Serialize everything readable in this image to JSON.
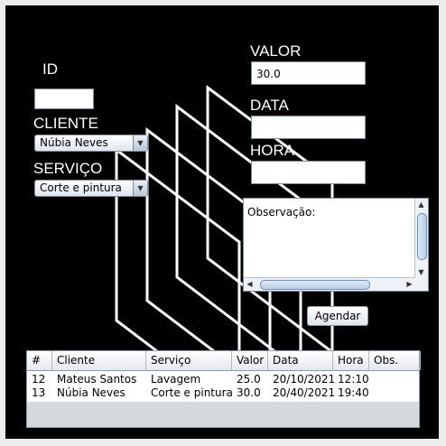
{
  "form": {
    "id_label": "ID",
    "id_value": "",
    "cliente_label": "CLIENTE",
    "cliente_selected": "Núbia Neves",
    "servico_label": "SERVIÇO",
    "servico_selected": "Corte e pintura",
    "valor_label": "VALOR",
    "valor_value": "30.0",
    "data_label": "DATA",
    "data_value": "",
    "hora_label": "HORA",
    "hora_value": "",
    "observacao_text": "Observação:",
    "agendar_label": "Agendar"
  },
  "table": {
    "headers": [
      "#",
      "Cliente",
      "Serviço",
      "Valor",
      "Data",
      "Hora",
      "Obs."
    ],
    "rows": [
      [
        "12",
        "Mateus Santos",
        "Lavagem",
        "25.0",
        "20/10/2021",
        "12:10",
        ""
      ],
      [
        "13",
        "Núbia Neves",
        "Corte e pintura",
        "30.0",
        "20/40/2021",
        "19:40",
        ""
      ]
    ]
  },
  "icons": {
    "combo_arrow": "chevron-down-icon",
    "scroll_up": "arrow-up-icon",
    "scroll_down": "arrow-down-icon",
    "scroll_left": "arrow-left-icon",
    "scroll_right": "arrow-right-icon"
  },
  "colors": {
    "background": "#000000",
    "label_text": "#ffffff",
    "decoration_lines": "#ffffff"
  }
}
